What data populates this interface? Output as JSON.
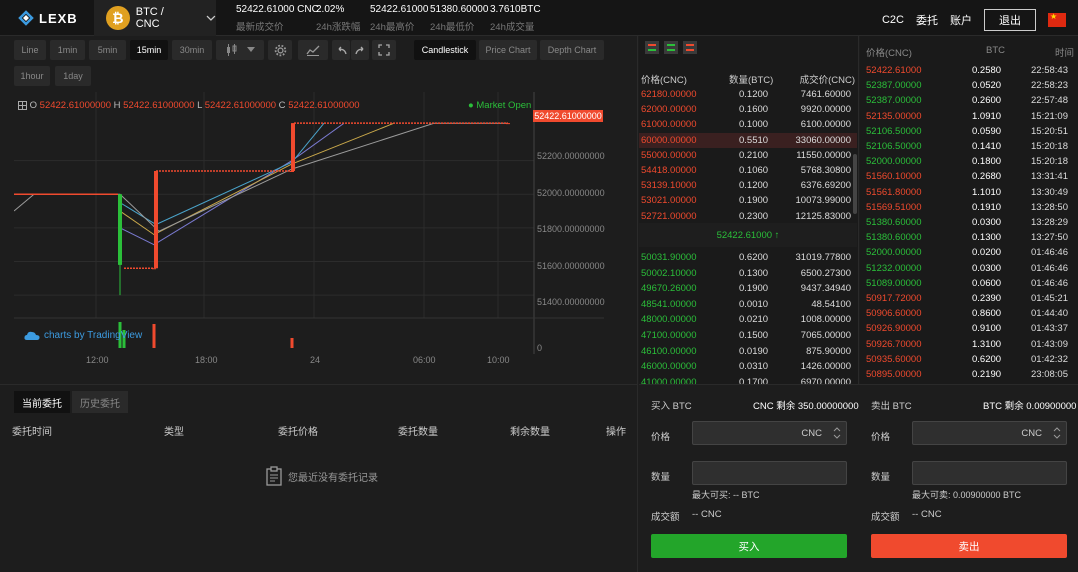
{
  "header": {
    "logo_text": "LEXB",
    "pair_label": "BTC / CNC",
    "coin_symbol": "₿",
    "stats": [
      {
        "value": "52422.61000 CNC",
        "label": "最新成交价"
      },
      {
        "value": "2.02%",
        "label": "24h涨跌幅"
      },
      {
        "value": "52422.61000",
        "label": "24h最高价"
      },
      {
        "value": "51380.60000",
        "label": "24h最低价"
      },
      {
        "value": "3.7610BTC",
        "label": "24h成交量"
      }
    ],
    "nav": {
      "c2c": "C2C",
      "orders": "委托",
      "account": "账户",
      "logout": "退出"
    }
  },
  "toolbar": {
    "intervals": [
      "Line",
      "1min",
      "5min",
      "15min",
      "30min",
      "1hour",
      "1day"
    ],
    "active_interval": "15min",
    "chart_modes": [
      "Candlestick",
      "Price Chart",
      "Depth Chart"
    ],
    "active_mode": "Candlestick"
  },
  "chart": {
    "ohlc": {
      "o_label": "O",
      "o": "52422.61000000",
      "h_label": "H",
      "h": "52422.61000000",
      "l_label": "L",
      "l": "52422.61000000",
      "c_label": "C",
      "c": "52422.61000000"
    },
    "market_status": "● Market Open",
    "current_price": "52422.61000000",
    "watermark": "charts by TradingView",
    "colors": {
      "up": "#2bbf3a",
      "down": "#f04a2e"
    }
  },
  "chart_data": {
    "type": "candlestick",
    "y_ticks": [
      "52200.00000000",
      "52000.00000000",
      "51800.00000000",
      "51600.00000000",
      "51400.00000000"
    ],
    "x_ticks": [
      "12:00",
      "18:00",
      "24",
      "06:00",
      "10:00"
    ],
    "volume_tick": "0",
    "ylim": [
      51300,
      52560
    ],
    "candles": [
      {
        "o": 52000,
        "h": 52000,
        "l": 51400,
        "c": 51580
      },
      {
        "o": 51560,
        "h": 51560,
        "l": 51560,
        "c": 51560
      },
      {
        "o": 51560,
        "h": 52138,
        "l": 51560,
        "c": 52138
      },
      {
        "o": 52138,
        "h": 52138,
        "l": 52138,
        "c": 52138
      },
      {
        "o": 52138,
        "h": 52422.61,
        "l": 52138,
        "c": 52422.61
      },
      {
        "o": 52422.61,
        "h": 52422.61,
        "l": 52422.61,
        "c": 52422.61
      }
    ]
  },
  "orders": {
    "tabs": [
      "当前委托",
      "历史委托"
    ],
    "columns": [
      "委托时间",
      "类型",
      "委托价格",
      "委托数量",
      "剩余数量",
      "操作"
    ],
    "empty_text": "您最近没有委托记录"
  },
  "orderbook": {
    "headers": [
      "价格(CNC)",
      "数量(BTC)",
      "成交价(CNC)"
    ],
    "asks": [
      [
        "62180.00000",
        "0.1200",
        "7461.60000"
      ],
      [
        "62000.00000",
        "0.1600",
        "9920.00000"
      ],
      [
        "61000.00000",
        "0.1000",
        "6100.00000"
      ],
      [
        "60000.00000",
        "0.5510",
        "33060.00000"
      ],
      [
        "55000.00000",
        "0.2100",
        "11550.00000"
      ],
      [
        "54418.00000",
        "0.1060",
        "5768.30800"
      ],
      [
        "53139.10000",
        "0.1200",
        "6376.69200"
      ],
      [
        "53021.00000",
        "0.1900",
        "10073.99000"
      ],
      [
        "52721.00000",
        "0.2300",
        "12125.83000"
      ]
    ],
    "mid_price": "52422.61000 ↑",
    "bids": [
      [
        "50031.90000",
        "0.6200",
        "31019.77800"
      ],
      [
        "50002.10000",
        "0.1300",
        "6500.27300"
      ],
      [
        "49670.26000",
        "0.1900",
        "9437.34940"
      ],
      [
        "48541.00000",
        "0.0010",
        "48.54100"
      ],
      [
        "48000.00000",
        "0.0210",
        "1008.00000"
      ],
      [
        "47100.00000",
        "0.1500",
        "7065.00000"
      ],
      [
        "46100.00000",
        "0.0190",
        "875.90000"
      ],
      [
        "46000.00000",
        "0.0310",
        "1426.00000"
      ],
      [
        "41000.00000",
        "0.1700",
        "6970.00000"
      ]
    ]
  },
  "trades": {
    "headers": [
      "价格(CNC)",
      "BTC",
      "时间"
    ],
    "rows": [
      [
        "52422.61000",
        "0.2580",
        "22:58:43",
        "r"
      ],
      [
        "52387.00000",
        "0.0520",
        "22:58:23",
        "g"
      ],
      [
        "52387.00000",
        "0.2600",
        "22:57:48",
        "g"
      ],
      [
        "52135.00000",
        "1.0910",
        "15:21:09",
        "r"
      ],
      [
        "52106.50000",
        "0.0590",
        "15:20:51",
        "g"
      ],
      [
        "52106.50000",
        "0.1410",
        "15:20:18",
        "g"
      ],
      [
        "52000.00000",
        "0.1800",
        "15:20:18",
        "g"
      ],
      [
        "51560.10000",
        "0.2680",
        "13:31:41",
        "r"
      ],
      [
        "51561.80000",
        "1.1010",
        "13:30:49",
        "r"
      ],
      [
        "51569.51000",
        "0.1910",
        "13:28:50",
        "r"
      ],
      [
        "51380.60000",
        "0.0300",
        "13:28:29",
        "g"
      ],
      [
        "51380.60000",
        "0.1300",
        "13:27:50",
        "g"
      ],
      [
        "52000.00000",
        "0.0200",
        "01:46:46",
        "g"
      ],
      [
        "51232.00000",
        "0.0300",
        "01:46:46",
        "g"
      ],
      [
        "51089.00000",
        "0.0600",
        "01:46:46",
        "g"
      ],
      [
        "50917.72000",
        "0.2390",
        "01:45:21",
        "r"
      ],
      [
        "50906.60000",
        "0.8600",
        "01:44:40",
        "r"
      ],
      [
        "50926.90000",
        "0.9100",
        "01:43:37",
        "r"
      ],
      [
        "50926.70000",
        "1.3100",
        "01:43:09",
        "r"
      ],
      [
        "50935.60000",
        "0.6200",
        "01:42:32",
        "r"
      ],
      [
        "50895.00000",
        "0.2190",
        "23:08:05",
        "r"
      ]
    ]
  },
  "buy": {
    "title": "买入 BTC",
    "balance": "CNC 剩余 350.00000000",
    "price_label": "价格",
    "price_unit": "CNC",
    "qty_label": "数量",
    "max": "最大可买: -- BTC",
    "amount_label": "成交额",
    "amount": "-- CNC",
    "button": "买入"
  },
  "sell": {
    "title": "卖出 BTC",
    "balance": "BTC 剩余 0.00900000",
    "price_label": "价格",
    "price_unit": "CNC",
    "qty_label": "数量",
    "max": "最大可卖: 0.00900000 BTC",
    "amount_label": "成交额",
    "amount": "-- CNC",
    "button": "卖出"
  }
}
